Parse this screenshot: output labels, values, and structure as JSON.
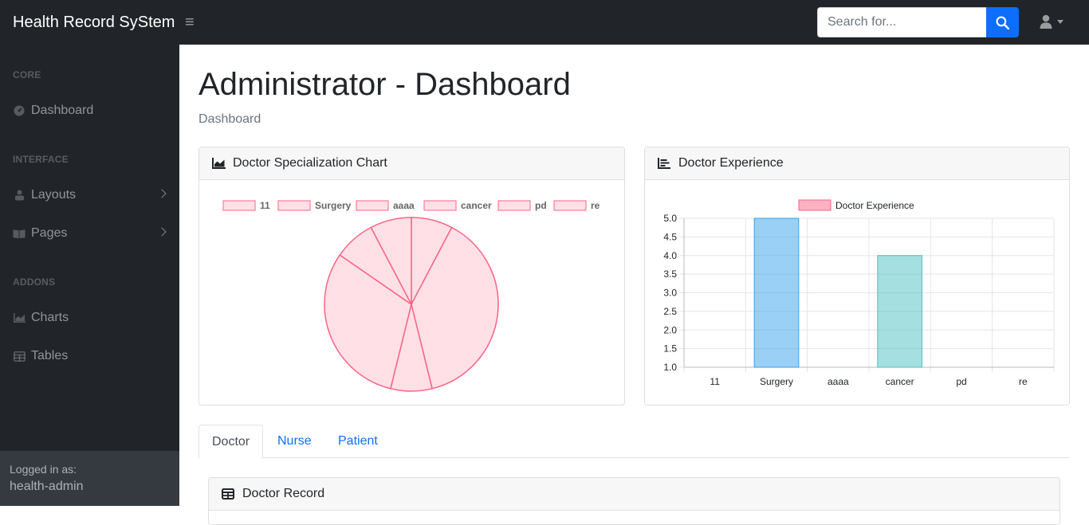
{
  "app": {
    "title": "Health Record SyStem"
  },
  "search": {
    "placeholder": "Search for..."
  },
  "sidebar": {
    "sections": [
      {
        "heading": "CORE",
        "items": [
          {
            "label": "Dashboard",
            "icon": "gauge-icon"
          }
        ]
      },
      {
        "heading": "INTERFACE",
        "items": [
          {
            "label": "Layouts",
            "icon": "columns-icon"
          },
          {
            "label": "Pages",
            "icon": "book-icon"
          }
        ]
      },
      {
        "heading": "ADDONS",
        "items": [
          {
            "label": "Charts",
            "icon": "area-chart-icon"
          },
          {
            "label": "Tables",
            "icon": "table-icon"
          }
        ]
      }
    ],
    "footer": {
      "caption": "Logged in as:",
      "user": "health-admin"
    }
  },
  "page": {
    "title": "Administrator - Dashboard",
    "breadcrumb": "Dashboard"
  },
  "cards": {
    "specialization": {
      "title": "Doctor Specialization Chart"
    },
    "experience": {
      "title": "Doctor Experience"
    },
    "record": {
      "title": "Doctor Record"
    }
  },
  "tabs": [
    {
      "label": "Doctor",
      "active": true
    },
    {
      "label": "Nurse",
      "active": false
    },
    {
      "label": "Patient",
      "active": false
    }
  ],
  "colors": {
    "accent": "#0d6efd",
    "nav_bg": "#212529",
    "pie_fill": "#ffe0e6",
    "pie_stroke": "#ff6384"
  },
  "chart_data": [
    {
      "type": "pie",
      "categories": [
        "11",
        "Surgery",
        "aaaa",
        "cancer",
        "pd",
        "re"
      ],
      "values": [
        1,
        5,
        1,
        4,
        1,
        1
      ],
      "legend": "top"
    },
    {
      "type": "bar",
      "categories": [
        "11",
        "Surgery",
        "aaaa",
        "cancer",
        "pd",
        "re"
      ],
      "series": [
        {
          "name": "Doctor Experience",
          "values": [
            1,
            5,
            1,
            4,
            1,
            1
          ]
        }
      ],
      "bar_colors": [
        "#ff6384",
        "#36a2eb",
        "#ffce56",
        "#4bc0c0",
        "#9966ff",
        "#ff9f40"
      ],
      "yticks": [
        "5.0",
        "4.5",
        "4.0",
        "3.5",
        "3.0",
        "2.5",
        "2.0",
        "1.5",
        "1.0"
      ],
      "ylim": [
        1,
        5
      ],
      "grid": true,
      "legend": "top"
    }
  ]
}
